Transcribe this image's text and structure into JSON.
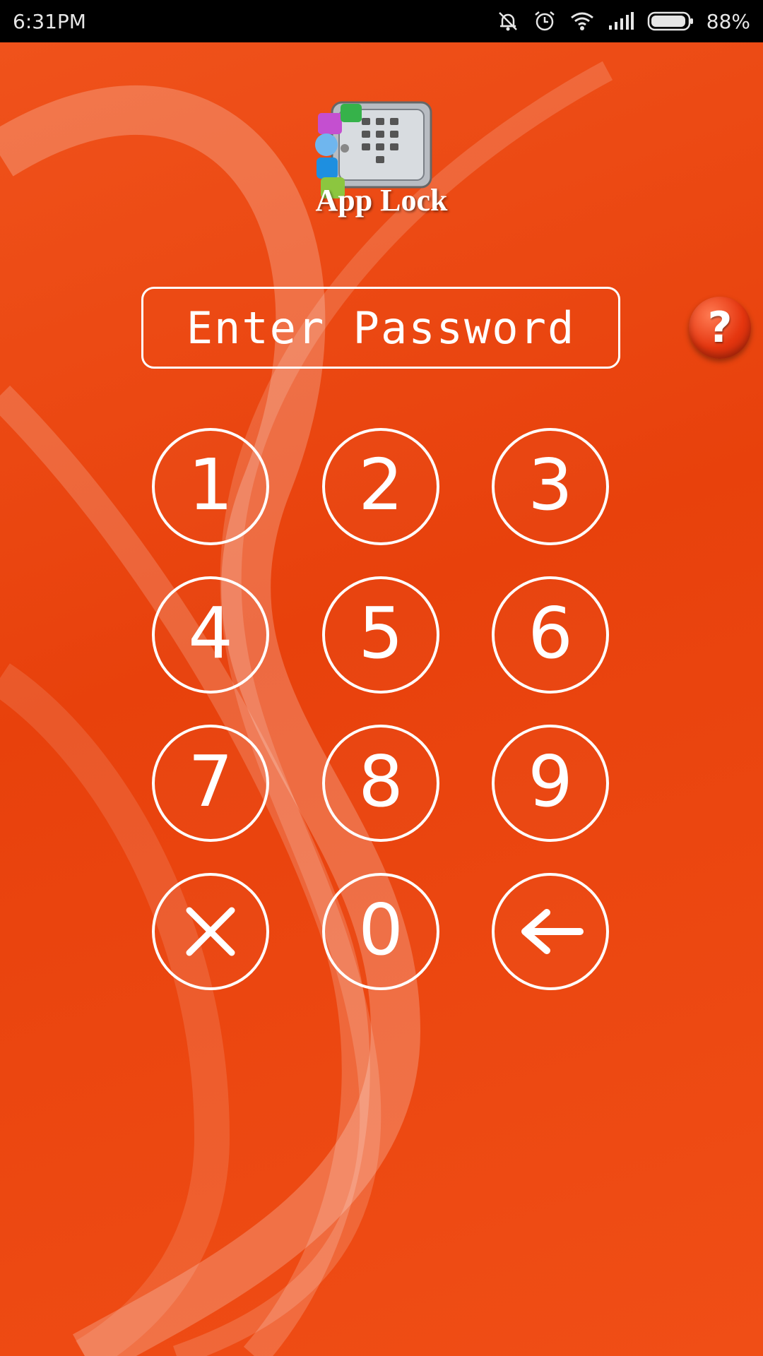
{
  "status_bar": {
    "time": "6:31PM",
    "battery_percent": "88%",
    "icons": [
      "mute-icon",
      "alarm-icon",
      "wifi-icon",
      "signal-icon",
      "battery-icon"
    ]
  },
  "app": {
    "title": "App Lock",
    "logo_icon": "safe-with-apps-icon"
  },
  "password_field": {
    "placeholder": "Enter Password"
  },
  "help_button": {
    "label": "?"
  },
  "keypad": {
    "keys": [
      "1",
      "2",
      "3",
      "4",
      "5",
      "6",
      "7",
      "8",
      "9",
      "×",
      "0",
      "←"
    ],
    "clear_icon": "close-icon",
    "backspace_icon": "back-arrow-icon"
  },
  "colors": {
    "background": "#e8410c",
    "accent": "#ffffff",
    "status_bar": "#000000"
  }
}
